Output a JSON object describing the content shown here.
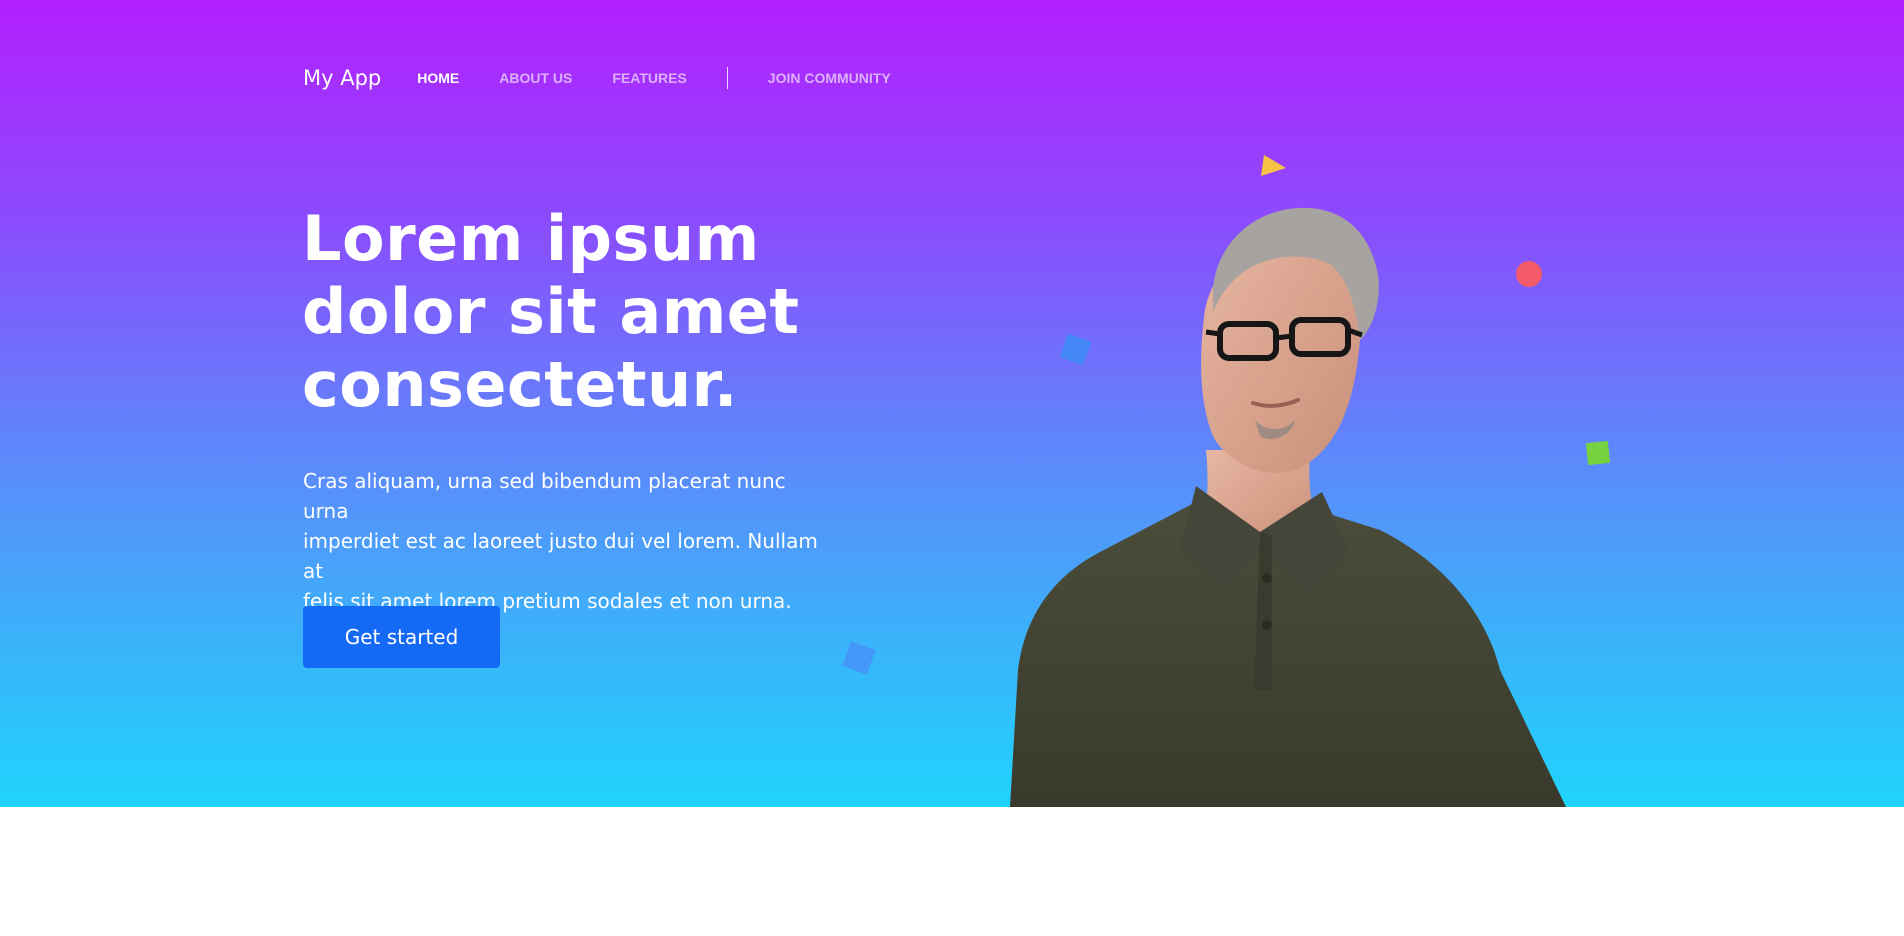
{
  "nav": {
    "brand": "My App",
    "links": [
      {
        "label": "HOME",
        "active": true
      },
      {
        "label": "ABOUT US",
        "active": false
      },
      {
        "label": "FEATURES",
        "active": false
      },
      {
        "label": "JOIN COMMUNITY",
        "active": false
      }
    ]
  },
  "hero": {
    "headline_lines": [
      "Lorem ipsum",
      "dolor sit amet",
      "consectetur."
    ],
    "subtext_lines": [
      "Cras aliquam, urna sed bibendum placerat nunc urna",
      "imperdiet est ac laoreet justo dui vel lorem. Nullam at",
      "felis sit amet lorem pretium sodales et non urna."
    ],
    "cta_label": "Get started"
  },
  "colors": {
    "gradient_top": "#b31ffe",
    "gradient_bottom": "#20d4fb",
    "button": "#156af5",
    "deco_triangle": "#f6c344",
    "deco_circle": "#f35a6a",
    "deco_square_blue": "#3c8cf5",
    "deco_square_green": "#76d23f"
  },
  "icons": {
    "hero_person": "person-with-glasses-illustration"
  }
}
